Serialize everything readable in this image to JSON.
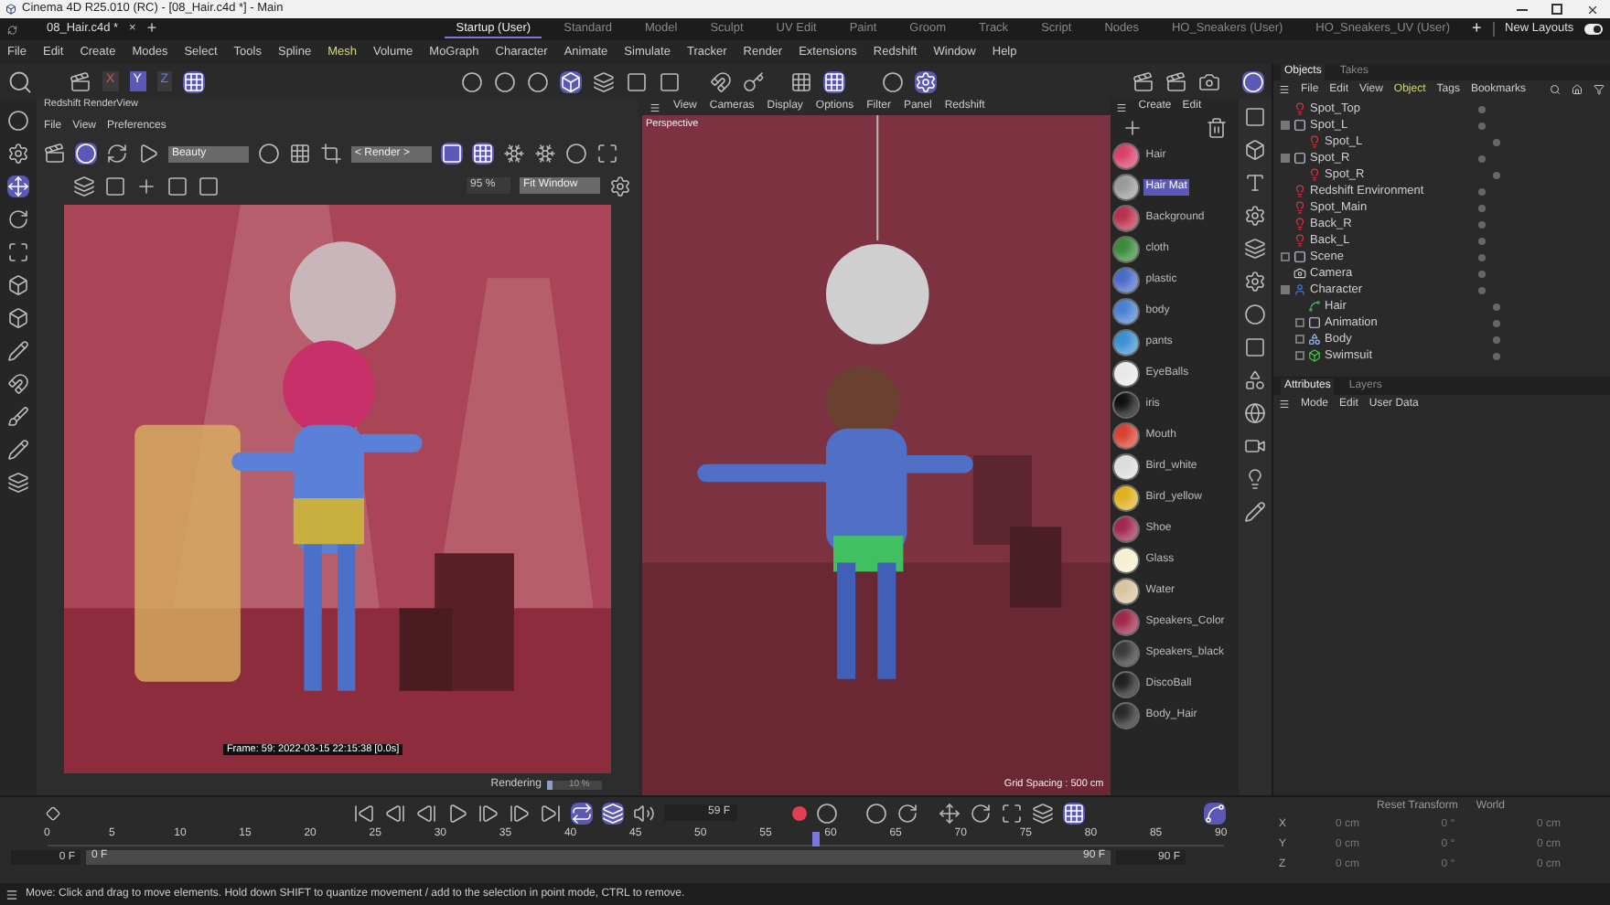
{
  "window": {
    "title": "Cinema 4D R25.010 (RC) - [08_Hair.c4d *] - Main"
  },
  "document_tab": {
    "label": "08_Hair.c4d *",
    "close": "×",
    "add": "+"
  },
  "layouts": [
    {
      "label": "Startup (User)",
      "selected": true
    },
    {
      "label": "Standard",
      "selected": false
    },
    {
      "label": "Model",
      "selected": false
    },
    {
      "label": "Sculpt",
      "selected": false
    },
    {
      "label": "UV Edit",
      "selected": false
    },
    {
      "label": "Paint",
      "selected": false
    },
    {
      "label": "Groom",
      "selected": false
    },
    {
      "label": "Track",
      "selected": false
    },
    {
      "label": "Script",
      "selected": false
    },
    {
      "label": "Nodes",
      "selected": false
    },
    {
      "label": "HO_Sneakers (User)",
      "selected": false
    },
    {
      "label": "HO_Sneakers_UV (User)",
      "selected": false
    }
  ],
  "new_layouts": {
    "label": "New Layouts",
    "on": true
  },
  "menu": [
    {
      "label": "File",
      "highlighted": false
    },
    {
      "label": "Edit",
      "highlighted": false
    },
    {
      "label": "Create",
      "highlighted": false
    },
    {
      "label": "Modes",
      "highlighted": false
    },
    {
      "label": "Select",
      "highlighted": false
    },
    {
      "label": "Tools",
      "highlighted": false
    },
    {
      "label": "Spline",
      "highlighted": false
    },
    {
      "label": "Mesh",
      "highlighted": true
    },
    {
      "label": "Volume",
      "highlighted": false
    },
    {
      "label": "MoGraph",
      "highlighted": false
    },
    {
      "label": "Character",
      "highlighted": false
    },
    {
      "label": "Animate",
      "highlighted": false
    },
    {
      "label": "Simulate",
      "highlighted": false
    },
    {
      "label": "Tracker",
      "highlighted": false
    },
    {
      "label": "Render",
      "highlighted": false
    },
    {
      "label": "Extensions",
      "highlighted": false
    },
    {
      "label": "Redshift",
      "highlighted": false
    },
    {
      "label": "Window",
      "highlighted": false
    },
    {
      "label": "Help",
      "highlighted": false
    }
  ],
  "axis_buttons": [
    {
      "label": "X",
      "selected": false
    },
    {
      "label": "Y",
      "selected": true
    },
    {
      "label": "Z",
      "selected": false
    }
  ],
  "render_view": {
    "title": "Redshift RenderView",
    "menu": [
      "File",
      "View",
      "Preferences"
    ],
    "aov": "Beauty",
    "camera": "< Render >",
    "zoom": "95 %",
    "fit": "Fit Window",
    "frame_info": "Frame: 59: 2022-03-15 22:15:38 [0.0s]",
    "status": "Rendering",
    "progress": {
      "level": 0.1,
      "reading": "10 %"
    }
  },
  "viewport": {
    "menu": [
      "View",
      "Cameras",
      "Display",
      "Options",
      "Filter",
      "Panel",
      "Redshift"
    ],
    "camera": "Perspective",
    "grid": "Grid Spacing : 500 cm"
  },
  "materials": {
    "menu": [
      "Create",
      "Edit"
    ],
    "items": [
      {
        "name": "Hair",
        "color": "#d8406a",
        "selected": false
      },
      {
        "name": "Hair Mat",
        "color": "#9a9a9a",
        "selected": true
      },
      {
        "name": "Background",
        "color": "#b8304e",
        "selected": false
      },
      {
        "name": "cloth",
        "color": "#3a8a3a",
        "selected": false
      },
      {
        "name": "plastic",
        "color": "#4a6ac8",
        "selected": false
      },
      {
        "name": "body",
        "color": "#4a80d0",
        "selected": false
      },
      {
        "name": "pants",
        "color": "#3a90d0",
        "selected": false
      },
      {
        "name": "EyeBalls",
        "color": "#e8e8e8",
        "selected": false
      },
      {
        "name": "iris",
        "color": "#111111",
        "selected": false
      },
      {
        "name": "Mouth",
        "color": "#d84030",
        "selected": false
      },
      {
        "name": "Bird_white",
        "color": "#dcdcdc",
        "selected": false
      },
      {
        "name": "Bird_yellow",
        "color": "#e0b020",
        "selected": false
      },
      {
        "name": "Shoe",
        "color": "#a02850",
        "selected": false
      },
      {
        "name": "Glass",
        "color": "#f4f0d0",
        "selected": false
      },
      {
        "name": "Water",
        "color": "#d8c4a0",
        "selected": false
      },
      {
        "name": "Speakers_Color",
        "color": "#a0284a",
        "selected": false
      },
      {
        "name": "Speakers_black",
        "color": "#3a3a3a",
        "selected": false
      },
      {
        "name": "DiscoBall",
        "color": "#202020",
        "selected": false
      },
      {
        "name": "Body_Hair",
        "color": "#2a2a2a",
        "selected": false
      }
    ]
  },
  "objects": {
    "tabs": [
      {
        "label": "Objects",
        "selected": true
      },
      {
        "label": "Takes",
        "selected": false
      }
    ],
    "menu": [
      {
        "label": "File",
        "highlighted": false
      },
      {
        "label": "Edit",
        "highlighted": false
      },
      {
        "label": "View",
        "highlighted": false
      },
      {
        "label": "Object",
        "highlighted": true
      },
      {
        "label": "Tags",
        "highlighted": false
      },
      {
        "label": "Bookmarks",
        "highlighted": false
      }
    ],
    "tree": [
      {
        "name": "Spot_Top",
        "kind": "light"
      },
      {
        "name": "Spot_L",
        "kind": "null",
        "expanded": true,
        "children": [
          {
            "name": "Spot_L",
            "kind": "light"
          }
        ]
      },
      {
        "name": "Spot_R",
        "kind": "null",
        "expanded": true,
        "children": [
          {
            "name": "Spot_R",
            "kind": "light"
          }
        ]
      },
      {
        "name": "Redshift Environment",
        "kind": "light"
      },
      {
        "name": "Spot_Main",
        "kind": "light"
      },
      {
        "name": "Back_R",
        "kind": "light"
      },
      {
        "name": "Back_L",
        "kind": "light"
      },
      {
        "name": "Scene",
        "kind": "null",
        "expanded": false
      },
      {
        "name": "Camera",
        "kind": "camera"
      },
      {
        "name": "Character",
        "kind": "character",
        "expanded": true,
        "children": [
          {
            "name": "Hair",
            "kind": "hair"
          },
          {
            "name": "Animation",
            "kind": "null",
            "expanded": false
          },
          {
            "name": "Body",
            "kind": "joint",
            "expanded": false
          },
          {
            "name": "Swimsuit",
            "kind": "mesh",
            "expanded": false
          }
        ]
      }
    ]
  },
  "attributes": {
    "tabs": [
      {
        "label": "Attributes",
        "selected": true
      },
      {
        "label": "Layers",
        "selected": false
      }
    ],
    "menu": [
      "Mode",
      "Edit",
      "User Data"
    ]
  },
  "timeline": {
    "current": "59 F",
    "ticks": [
      "0",
      "5",
      "10",
      "15",
      "20",
      "25",
      "30",
      "35",
      "40",
      "45",
      "50",
      "55",
      "60",
      "65",
      "70",
      "75",
      "80",
      "85",
      "90"
    ],
    "level": 0.656,
    "start": "0 F",
    "range": {
      "level": 1
    },
    "range_start": "0 F",
    "range_end": "90 F",
    "end": "90 F"
  },
  "coordinates": {
    "buttons": [
      "Reset Transform",
      "World"
    ],
    "rows": [
      {
        "axis": "X",
        "position": "0 cm",
        "rotation": "0 °",
        "scale": "0 cm"
      },
      {
        "axis": "Y",
        "position": "0 cm",
        "rotation": "0 °",
        "scale": "0 cm"
      },
      {
        "axis": "Z",
        "position": "0 cm",
        "rotation": "0 °",
        "scale": "0 cm"
      }
    ]
  },
  "status_bar": "Move: Click and drag to move elements. Hold down SHIFT to quantize movement / add to the selection in point mode, CTRL to remove."
}
